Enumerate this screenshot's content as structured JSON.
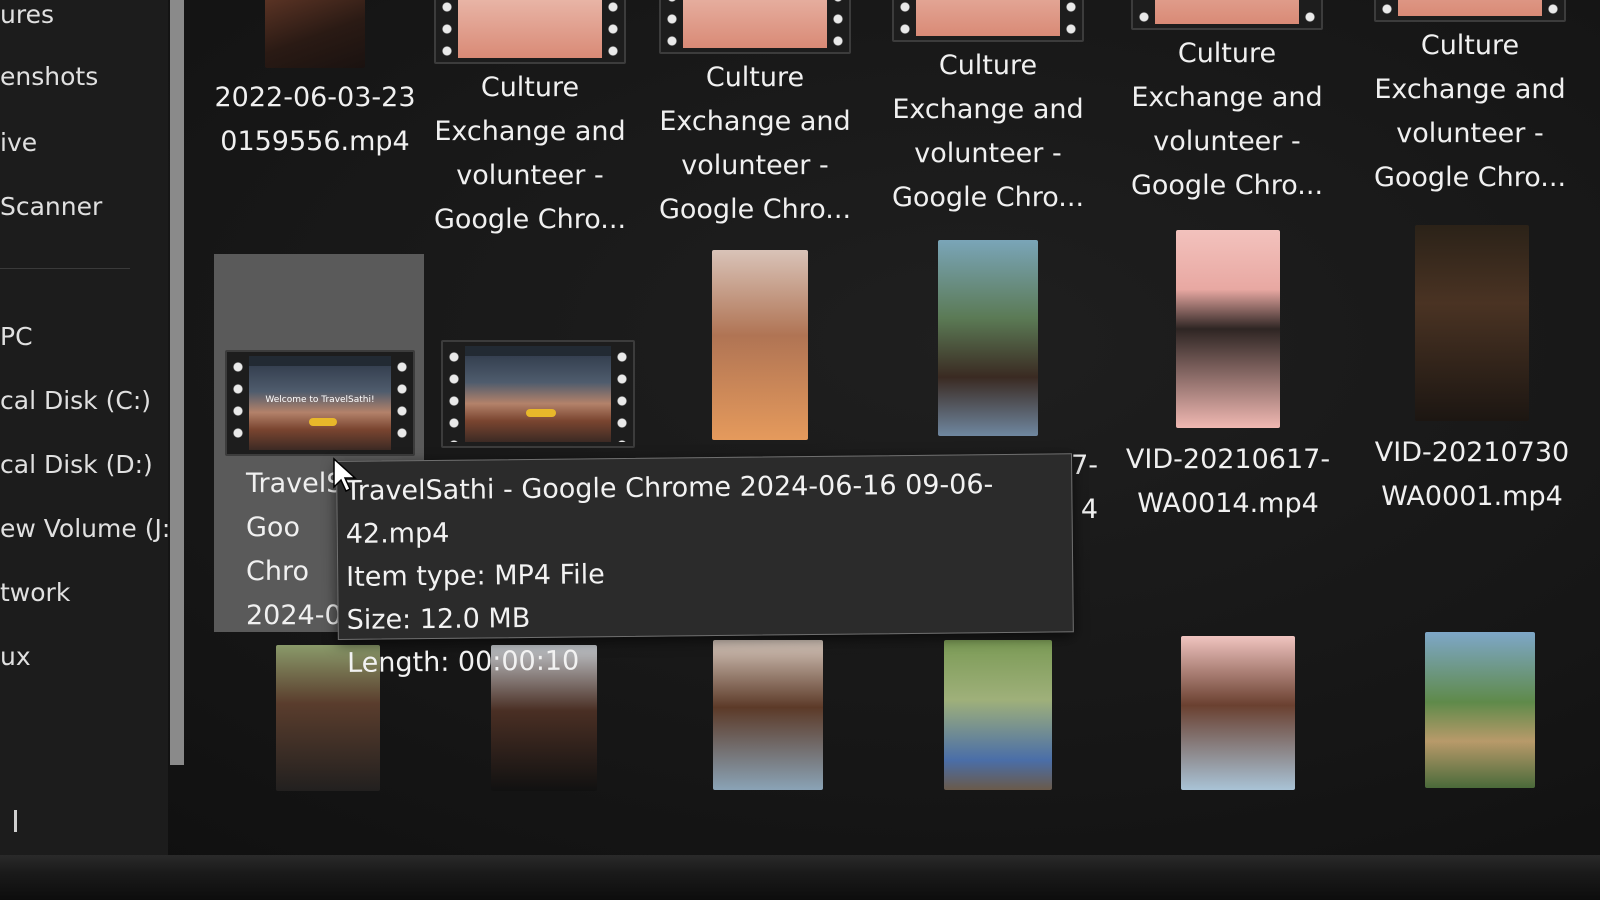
{
  "sidebar": {
    "items": [
      {
        "label": "ures"
      },
      {
        "label": "enshots"
      },
      {
        "label": "ive"
      },
      {
        "label": "Scanner"
      },
      {
        "label": " PC"
      },
      {
        "label": "cal Disk (C:)"
      },
      {
        "label": "cal Disk (D:)"
      },
      {
        "label": "ew Volume (J:"
      },
      {
        "label": "twork"
      },
      {
        "label": "ux"
      }
    ]
  },
  "grid": {
    "row1": [
      {
        "label": "2022-06-03-23\n0159556.mp4",
        "kind": "photo"
      },
      {
        "label": "Culture\nExchange and\nvolunteer -\nGoogle Chro...",
        "kind": "film-pink"
      },
      {
        "label": "Culture\nExchange and\nvolunteer -\nGoogle Chro...",
        "kind": "film-pink"
      },
      {
        "label": "Culture\nExchange and\nvolunteer -\nGoogle Chro...",
        "kind": "film-pink"
      },
      {
        "label": "Culture\nExchange and\nvolunteer -\nGoogle Chro...",
        "kind": "film-pink"
      },
      {
        "label": "Culture\nExchange and\nvolunteer -\nGoogle Chro...",
        "kind": "film-pink"
      }
    ],
    "row2": [
      {
        "label": "TravelS\nGoo\nChro\n2024-06",
        "kind": "film-travel",
        "selected": true
      },
      {
        "label": "",
        "kind": "film-travel"
      },
      {
        "label": "",
        "kind": "photo"
      },
      {
        "label": "7-\n4",
        "kind": "photo"
      },
      {
        "label": "VID-20210617-\nWA0014.mp4",
        "kind": "photo"
      },
      {
        "label": "VID-20210730\nWA0001.mp4",
        "kind": "photo"
      }
    ],
    "travel_welcome": "Welcome to TravelSathi!"
  },
  "tooltip": {
    "name": "TravelSathi - Google Chrome 2024-06-16 09-06-42.mp4",
    "type": "Item type: MP4 File",
    "size": "Size: 12.0 MB",
    "length": "Length: 00:00:10"
  },
  "colors": {
    "background": "#161616",
    "selection": "#5a5a5a",
    "tooltip_bg": "#2b2b2b",
    "text": "#f0f0f0"
  }
}
